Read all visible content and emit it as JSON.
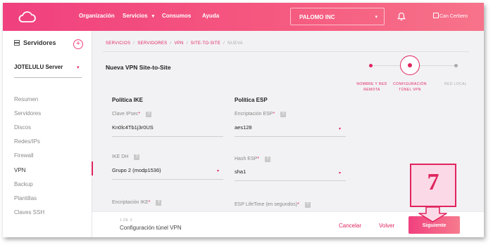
{
  "topbar": {
    "logo_icon": "cloud-icon",
    "nav": [
      {
        "label": "Organización"
      },
      {
        "label": "Servicios",
        "caret": "▾"
      },
      {
        "label": "Consumos"
      },
      {
        "label": "Ayuda"
      }
    ],
    "org_select": {
      "value": "PALOMO INC",
      "caret": "▾"
    },
    "bell_icon": "bell-icon",
    "avatar_alt": "Can Cerbero"
  },
  "sidebar": {
    "title": "Servidores",
    "add_label": "+",
    "server_select": {
      "value": "JOTELULU Server",
      "caret": "▾"
    },
    "items": [
      {
        "label": "Resumen"
      },
      {
        "label": "Servidores"
      },
      {
        "label": "Discos"
      },
      {
        "label": "Redes/IPs"
      },
      {
        "label": "Firewall"
      },
      {
        "label": "VPN",
        "active": true
      },
      {
        "label": "Backup"
      },
      {
        "label": "Plantillas"
      },
      {
        "label": "Claves SSH"
      }
    ]
  },
  "breadcrumb": {
    "items": [
      "SERVICIOS",
      "SERVIDORES",
      "VPN",
      "SITE-TO-SITE"
    ],
    "current": "NUEVA",
    "separator": "/"
  },
  "page_title": "Nueva VPN Site-to-Site",
  "stepper": {
    "steps": [
      {
        "label_line1": "NOMBRE Y RED",
        "label_line2": "REMOTA",
        "state": "done"
      },
      {
        "label_line1": "CONFIGURACIÓN",
        "label_line2": "TÚNEL VPN",
        "state": "current"
      },
      {
        "label_line1": "RED LOCAL",
        "label_line2": "",
        "state": "pending"
      }
    ]
  },
  "ike": {
    "title": "Política IKE",
    "psk": {
      "label": "Clave IPsec",
      "value": "Kn0lc4Tb1j3r0US",
      "help": "?"
    },
    "dh": {
      "label": "IKE DH",
      "value": "Grupo 2 (modp1536)",
      "help": "?",
      "caret": "▾"
    },
    "enc": {
      "label": "Encriptación IKE",
      "help": "?"
    }
  },
  "esp": {
    "title": "Política ESP",
    "enc": {
      "label": "Encriptación ESP",
      "value": "aes128",
      "help": "?",
      "caret": "▾"
    },
    "hash": {
      "label": "Hash ESP",
      "value": "sha1",
      "help": "?",
      "caret": "▾"
    },
    "lifetime": {
      "label": "ESP LifeTime (en segundos)",
      "help": "?"
    }
  },
  "required_mark": "*",
  "bottom": {
    "step": "1 DE 3",
    "name": "Configuración túnel VPN",
    "cancel": "Cancelar",
    "back": "Volver",
    "next": "Siguiente"
  },
  "callout": {
    "number": "7"
  },
  "colors": {
    "accent": "#e0245e",
    "topbar_start": "#f0407f",
    "topbar_end": "#f7738a"
  }
}
